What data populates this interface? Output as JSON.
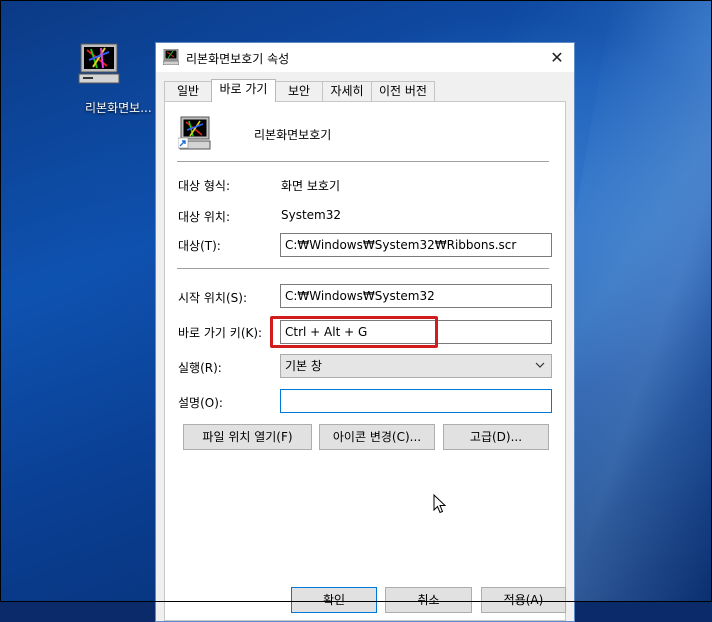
{
  "desktop": {
    "icon_label": "리본화면보..."
  },
  "window": {
    "title": "리본화면보호기 속성",
    "close_glyph": "✕"
  },
  "tabs": [
    {
      "label": "일반"
    },
    {
      "label": "바로 가기",
      "active": true
    },
    {
      "label": "보안"
    },
    {
      "label": "자세히"
    },
    {
      "label": "이전 버전"
    }
  ],
  "shortcut": {
    "name": "리본화면보호기",
    "target_type_label": "대상 형식:",
    "target_type_value": "화면 보호기",
    "target_location_label": "대상 위치:",
    "target_location_value": "System32",
    "target_label": "대상(T):",
    "target_value": "C:₩Windows₩System32₩Ribbons.scr",
    "start_in_label": "시작 위치(S):",
    "start_in_value": "C:₩Windows₩System32",
    "hotkey_label": "바로 가기 키(K):",
    "hotkey_value": "Ctrl + Alt + G",
    "run_label": "실행(R):",
    "run_value": "기본 창",
    "comment_label": "설명(O):",
    "comment_value": ""
  },
  "buttons": {
    "open_location": "파일 위치 열기(F)",
    "change_icon": "아이콘 변경(C)...",
    "advanced": "고급(D)...",
    "ok": "확인",
    "cancel": "취소",
    "apply": "적용(A)"
  },
  "colors": {
    "highlight_box": "#d01c1c",
    "focus_border": "#0078d7",
    "desktop_blue": "#0e52b0"
  },
  "icons": {
    "screensaver": "screensaver-monitor-icon",
    "shortcut_arrow": "shortcut-arrow-icon",
    "dropdown": "chevron-down-icon",
    "close": "close-icon",
    "cursor": "mouse-pointer-icon"
  }
}
